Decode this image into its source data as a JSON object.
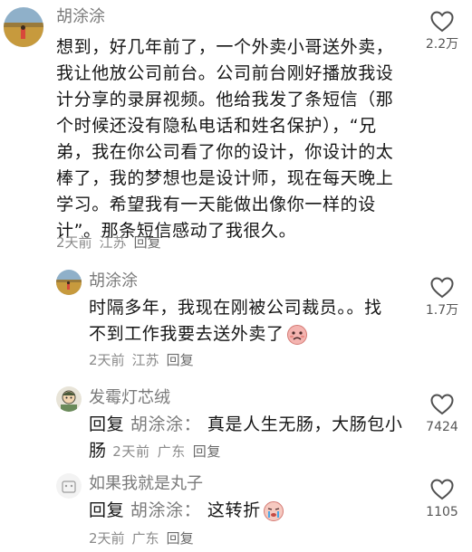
{
  "comments": [
    {
      "username": "胡涂涂",
      "lines": [
        "想到，好几年前了，一个外卖小哥送外卖，",
        "我让他放公司前台。公司前台刚好播放我设",
        "计分享的录屏视频。他给我发了条短信（那",
        "个时候还没有隐私电话和姓名保护），“兄",
        "弟，我在你公司看了你的设计，你设计的太",
        "棒了，我的梦想也是设计师，现在每天晚上",
        "学习。希望我有一天能做出像你一样的设",
        "计”。那条短信感动了我很久。"
      ],
      "time": "2天前",
      "location": "江苏",
      "reply_label": "回复",
      "likes": "2.2万",
      "avatar_icon": "wheat-field-avatar"
    },
    {
      "username": "胡涂涂",
      "lines": [
        "时隔多年，我现在刚被公司裁员。。找",
        "不到工作我要去送外卖了"
      ],
      "emoji": "sad-face-emoji",
      "time": "2天前",
      "location": "江苏",
      "reply_label": "回复",
      "likes": "1.7万",
      "avatar_icon": "wheat-field-avatar"
    },
    {
      "username": "发霉灯芯绒",
      "reply_prefix": "回复",
      "reply_target": "胡涂涂：",
      "lines": [
        "真是人生无肠，大肠包小",
        "肠"
      ],
      "time": "2天前",
      "location": "广东",
      "reply_label": "回复",
      "likes": "7424",
      "avatar_icon": "cartoon-avatar"
    },
    {
      "username": "如果我就是丸子",
      "reply_prefix": "回复",
      "reply_target": "胡涂涂：",
      "lines": [
        "这转折"
      ],
      "emoji": "crying-face-emoji",
      "time": "2天前",
      "location": "广东",
      "reply_label": "回复",
      "likes": "1105",
      "avatar_icon": "default-avatar"
    }
  ],
  "colors": {
    "text": "#161616",
    "secondary": "#7a7a7a",
    "meta": "#8a8a8a"
  }
}
